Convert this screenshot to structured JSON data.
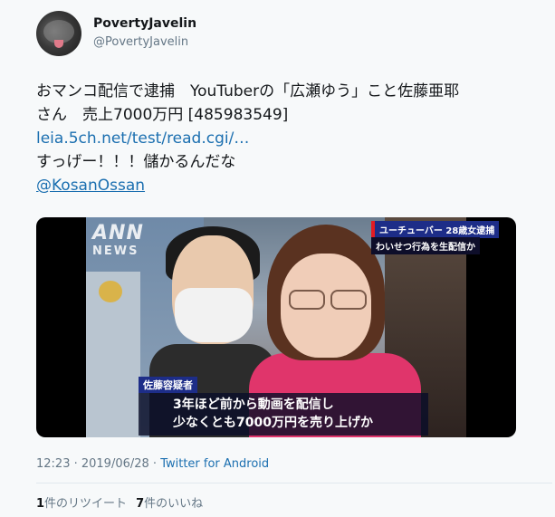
{
  "author": {
    "name": "PovertyJavelin",
    "handle": "@PovertyJavelin"
  },
  "tweet": {
    "line1": "おマンコ配信で逮捕　YouTuberの「広瀬ゆう」こと佐藤亜耶",
    "line2": "さん　売上7000万円 [485983549]",
    "link": "leia.5ch.net/test/read.cgi/…",
    "line4": "すっげー！！！儲かるんだな",
    "mention": "@KosanOssan"
  },
  "media": {
    "logo_top": "ANN",
    "logo_bottom": "NEWS",
    "caption_top": "ユーチューバー 28歳女逮捕",
    "caption_sub": "わいせつ行為を生配信か",
    "speaker": "佐藤容疑者",
    "subtitle_line1": "3年ほど前から動画を配信し",
    "subtitle_line2": "少なくとも7000万円を売り上げか"
  },
  "meta": {
    "time": "12:23 · 2019/06/28 · ",
    "source": "Twitter for Android"
  },
  "stats": {
    "retweets_count": "1",
    "retweets_label": "件のリツイート",
    "likes_count": "7",
    "likes_label": "件のいいね"
  },
  "colors": {
    "link": "#1b6fb0",
    "muted": "#657786",
    "background": "#f7f9fa"
  }
}
